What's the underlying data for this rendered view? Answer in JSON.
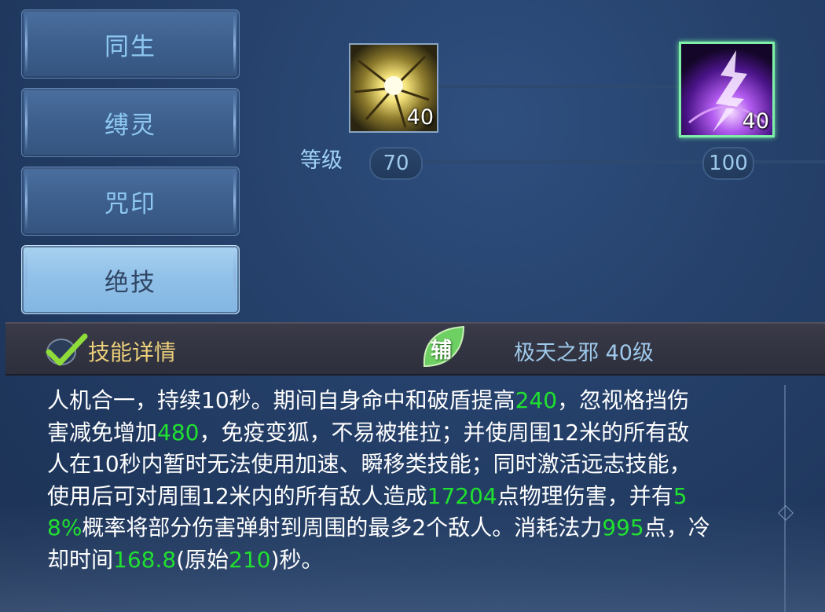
{
  "tabs": [
    {
      "label": "同生",
      "active": false
    },
    {
      "label": "缚灵",
      "active": false
    },
    {
      "label": "咒印",
      "active": false
    },
    {
      "label": "绝技",
      "active": true
    }
  ],
  "skill_tree": {
    "level_label": "等级",
    "skills": [
      {
        "icon": "golden-burst-icon",
        "count": "40",
        "level": "70",
        "selected": false
      },
      {
        "icon": "purple-lightning-icon",
        "count": "40",
        "level": "100",
        "selected": true
      }
    ]
  },
  "details": {
    "title": "技能详情",
    "check_icon": "check-icon",
    "badge": "辅",
    "skill_name": "极天之邪 40级",
    "description": [
      {
        "t": "人机合一，持续10秒。期间自身命中和破盾提高"
      },
      {
        "t": "240",
        "hl": true
      },
      {
        "t": "，忽视格挡伤害减免增加"
      },
      {
        "t": "480",
        "hl": true
      },
      {
        "t": "，免疫变狐，不易被推拉；并使周围12米的所有敌人在10秒内暂时无法使用加速、瞬移类技能；同时激活远志技能，使用后可对周围12米内的所有敌人造成"
      },
      {
        "t": "17204",
        "hl": true
      },
      {
        "t": "点物理伤害，并有"
      },
      {
        "t": "58%",
        "hl": true
      },
      {
        "t": "概率将部分伤害弹射到周围的最多2个敌人。消耗法力"
      },
      {
        "t": "995",
        "hl": true
      },
      {
        "t": "点，冷却时间"
      },
      {
        "t": "168.8",
        "hl": true
      },
      {
        "t": "(原始"
      },
      {
        "t": "210",
        "hl": true
      },
      {
        "t": ")秒。"
      }
    ]
  },
  "colors": {
    "highlight": "#20e030",
    "title_gold": "#ebcf7a",
    "tab_text": "#8ec8f2",
    "selected_border": "#7ff0a8"
  }
}
